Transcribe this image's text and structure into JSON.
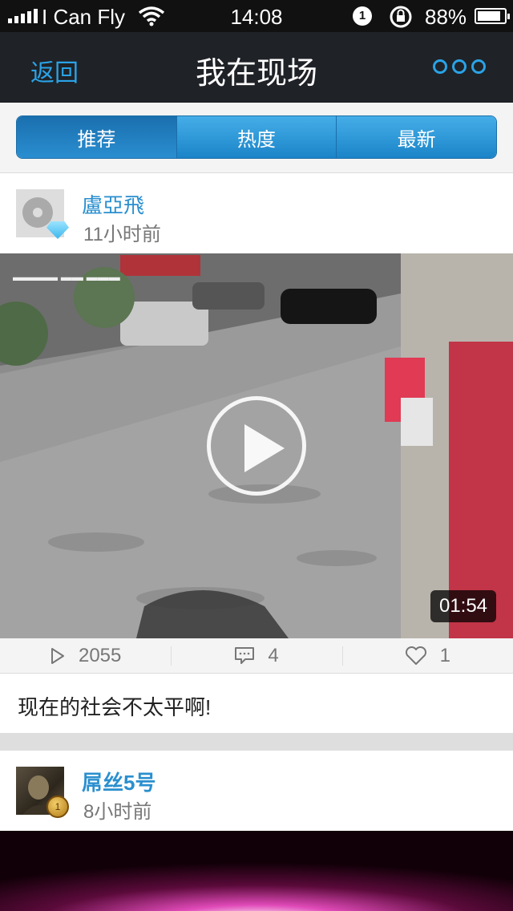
{
  "status_bar": {
    "carrier": "I Can Fly",
    "time": "14:08",
    "notification_count": "1",
    "battery_percent": "88%",
    "battery_level": 0.88
  },
  "nav": {
    "back_label": "返回",
    "title": "我在现场",
    "more_icon": "ellipsis-circles-icon"
  },
  "tabs": [
    {
      "label": "推荐",
      "active": true
    },
    {
      "label": "热度",
      "active": false
    },
    {
      "label": "最新",
      "active": false
    }
  ],
  "posts": [
    {
      "username": "盧亞飛",
      "time_ago": "11小时前",
      "avatar_icon": "disc-avatar-icon",
      "badge_icon": "diamond-badge-icon",
      "video_duration": "01:54",
      "play_count": "2055",
      "comment_count": "4",
      "like_count": "1",
      "caption": "现在的社会不太平啊!"
    },
    {
      "username": "屌丝5号",
      "time_ago": "8小时前",
      "avatar_icon": "photo-avatar-icon",
      "badge_icon": "gold-medal-icon",
      "medal_number": "1"
    }
  ],
  "colors": {
    "accent": "#2a8fcf",
    "nav_bg": "#1f2227",
    "tab_blue": "#1b84c8"
  }
}
